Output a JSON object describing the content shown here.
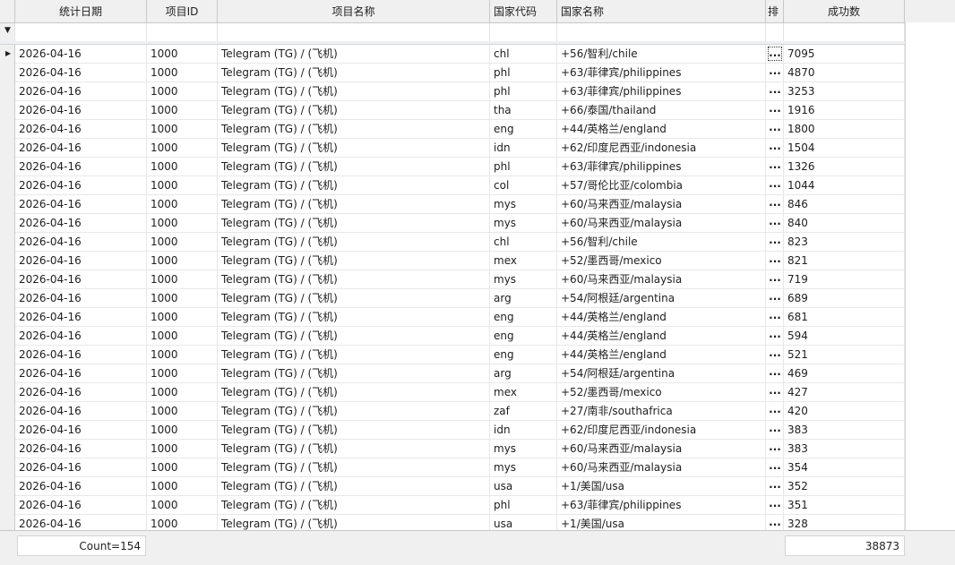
{
  "columns": [
    "统计日期",
    "项目ID",
    "项目名称",
    "国家代码",
    "国家名称",
    "排",
    "成功数"
  ],
  "filter_icon": "filter-icon",
  "row_indicator_icon": "current-row-triangle-icon",
  "ellipsis_label": "...",
  "rows": [
    {
      "date": "2026-04-16",
      "pid": "1000",
      "pname": "Telegram (TG) / (飞机)",
      "code": "chl",
      "country": "+56/智利/chile",
      "count": "7095"
    },
    {
      "date": "2026-04-16",
      "pid": "1000",
      "pname": "Telegram (TG) / (飞机)",
      "code": "phl",
      "country": "+63/菲律宾/philippines",
      "count": "4870"
    },
    {
      "date": "2026-04-16",
      "pid": "1000",
      "pname": "Telegram (TG) / (飞机)",
      "code": "phl",
      "country": "+63/菲律宾/philippines",
      "count": "3253"
    },
    {
      "date": "2026-04-16",
      "pid": "1000",
      "pname": "Telegram (TG) / (飞机)",
      "code": "tha",
      "country": "+66/泰国/thailand",
      "count": "1916"
    },
    {
      "date": "2026-04-16",
      "pid": "1000",
      "pname": "Telegram (TG) / (飞机)",
      "code": "eng",
      "country": "+44/英格兰/england",
      "count": "1800"
    },
    {
      "date": "2026-04-16",
      "pid": "1000",
      "pname": "Telegram (TG) / (飞机)",
      "code": "idn",
      "country": "+62/印度尼西亚/indonesia",
      "count": "1504"
    },
    {
      "date": "2026-04-16",
      "pid": "1000",
      "pname": "Telegram (TG) / (飞机)",
      "code": "phl",
      "country": "+63/菲律宾/philippines",
      "count": "1326"
    },
    {
      "date": "2026-04-16",
      "pid": "1000",
      "pname": "Telegram (TG) / (飞机)",
      "code": "col",
      "country": "+57/哥伦比亚/colombia",
      "count": "1044"
    },
    {
      "date": "2026-04-16",
      "pid": "1000",
      "pname": "Telegram (TG) / (飞机)",
      "code": "mys",
      "country": "+60/马来西亚/malaysia",
      "count": "846"
    },
    {
      "date": "2026-04-16",
      "pid": "1000",
      "pname": "Telegram (TG) / (飞机)",
      "code": "mys",
      "country": "+60/马来西亚/malaysia",
      "count": "840"
    },
    {
      "date": "2026-04-16",
      "pid": "1000",
      "pname": "Telegram (TG) / (飞机)",
      "code": "chl",
      "country": "+56/智利/chile",
      "count": "823"
    },
    {
      "date": "2026-04-16",
      "pid": "1000",
      "pname": "Telegram (TG) / (飞机)",
      "code": "mex",
      "country": "+52/墨西哥/mexico",
      "count": "821"
    },
    {
      "date": "2026-04-16",
      "pid": "1000",
      "pname": "Telegram (TG) / (飞机)",
      "code": "mys",
      "country": "+60/马来西亚/malaysia",
      "count": "719"
    },
    {
      "date": "2026-04-16",
      "pid": "1000",
      "pname": "Telegram (TG) / (飞机)",
      "code": "arg",
      "country": "+54/阿根廷/argentina",
      "count": "689"
    },
    {
      "date": "2026-04-16",
      "pid": "1000",
      "pname": "Telegram (TG) / (飞机)",
      "code": "eng",
      "country": "+44/英格兰/england",
      "count": "681"
    },
    {
      "date": "2026-04-16",
      "pid": "1000",
      "pname": "Telegram (TG) / (飞机)",
      "code": "eng",
      "country": "+44/英格兰/england",
      "count": "594"
    },
    {
      "date": "2026-04-16",
      "pid": "1000",
      "pname": "Telegram (TG) / (飞机)",
      "code": "eng",
      "country": "+44/英格兰/england",
      "count": "521"
    },
    {
      "date": "2026-04-16",
      "pid": "1000",
      "pname": "Telegram (TG) / (飞机)",
      "code": "arg",
      "country": "+54/阿根廷/argentina",
      "count": "469"
    },
    {
      "date": "2026-04-16",
      "pid": "1000",
      "pname": "Telegram (TG) / (飞机)",
      "code": "mex",
      "country": "+52/墨西哥/mexico",
      "count": "427"
    },
    {
      "date": "2026-04-16",
      "pid": "1000",
      "pname": "Telegram (TG) / (飞机)",
      "code": "zaf",
      "country": "+27/南非/southafrica",
      "count": "420"
    },
    {
      "date": "2026-04-16",
      "pid": "1000",
      "pname": "Telegram (TG) / (飞机)",
      "code": "idn",
      "country": "+62/印度尼西亚/indonesia",
      "count": "383"
    },
    {
      "date": "2026-04-16",
      "pid": "1000",
      "pname": "Telegram (TG) / (飞机)",
      "code": "mys",
      "country": "+60/马来西亚/malaysia",
      "count": "383"
    },
    {
      "date": "2026-04-16",
      "pid": "1000",
      "pname": "Telegram (TG) / (飞机)",
      "code": "mys",
      "country": "+60/马来西亚/malaysia",
      "count": "354"
    },
    {
      "date": "2026-04-16",
      "pid": "1000",
      "pname": "Telegram (TG) / (飞机)",
      "code": "usa",
      "country": "+1/美国/usa",
      "count": "352"
    },
    {
      "date": "2026-04-16",
      "pid": "1000",
      "pname": "Telegram (TG) / (飞机)",
      "code": "phl",
      "country": "+63/菲律宾/philippines",
      "count": "351"
    },
    {
      "date": "2026-04-16",
      "pid": "1000",
      "pname": "Telegram (TG) / (飞机)",
      "code": "usa",
      "country": "+1/美国/usa",
      "count": "328"
    }
  ],
  "footer": {
    "count_summary": "Count=154",
    "total_summary": "38873"
  }
}
